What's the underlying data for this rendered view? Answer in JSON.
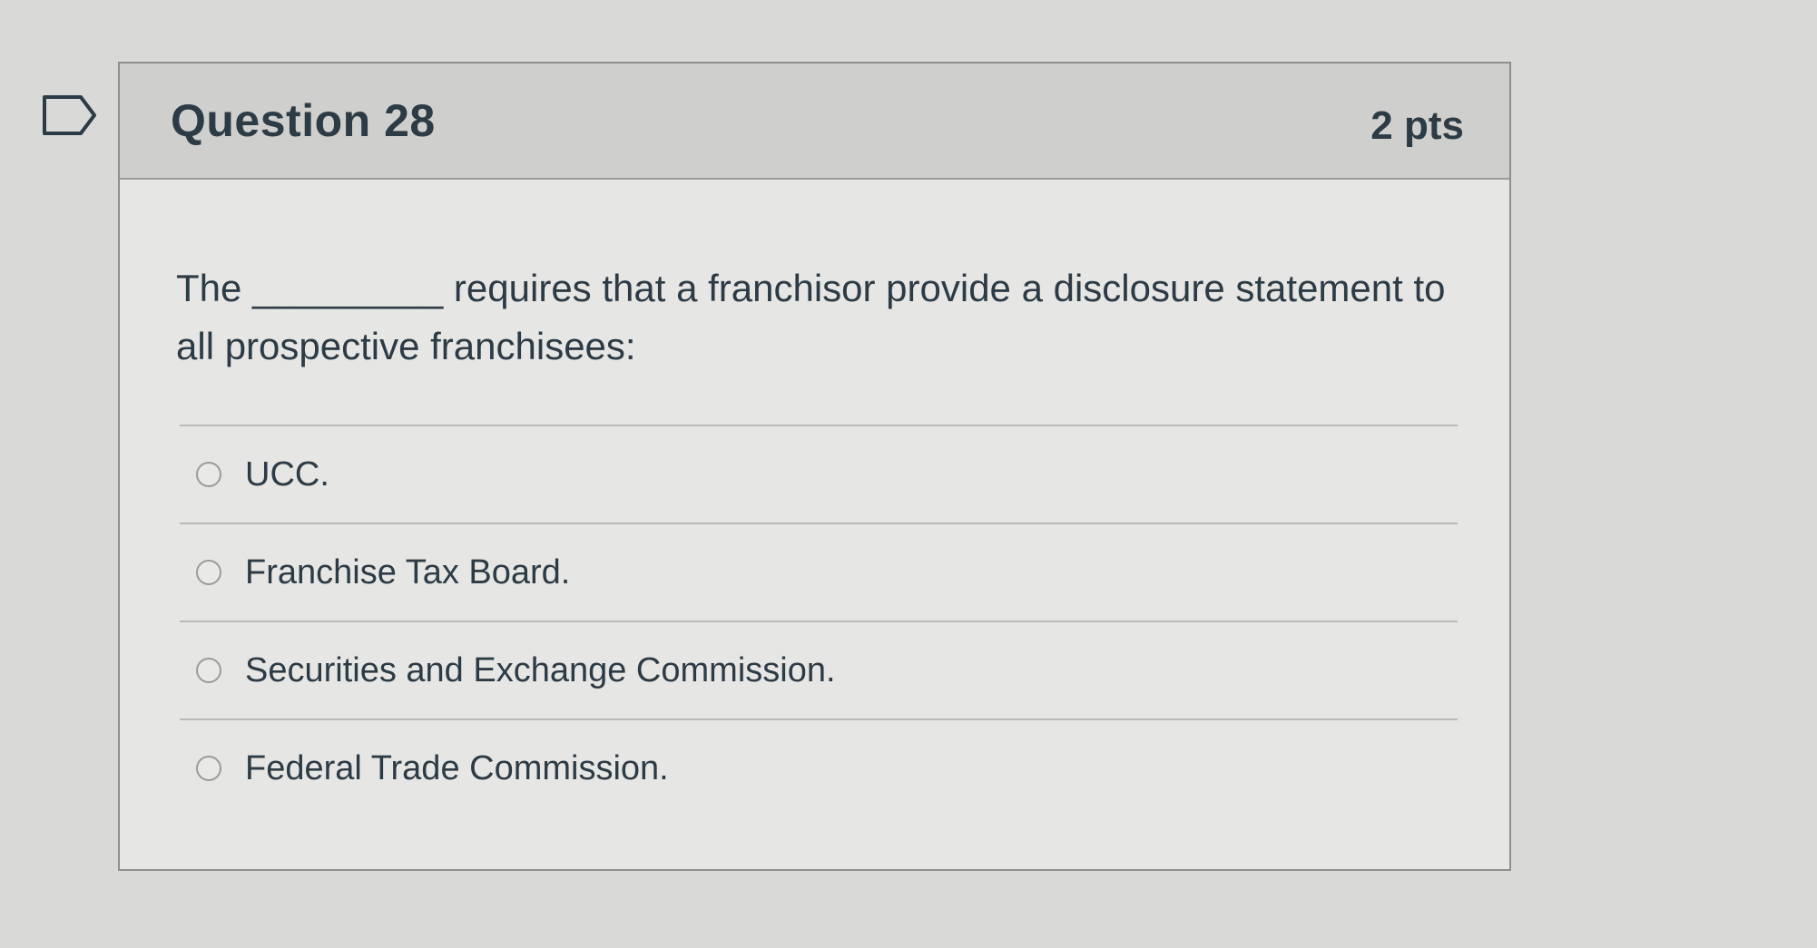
{
  "question": {
    "title": "Question 28",
    "points": "2 pts",
    "text": "The _________ requires that a franchisor provide a disclosure statement to all prospective franchisees:",
    "bookmark_icon": "bookmark-flag-icon"
  },
  "answers": [
    {
      "label": "UCC."
    },
    {
      "label": "Franchise Tax Board."
    },
    {
      "label": "Securities and Exchange Commission."
    },
    {
      "label": "Federal Trade Commission."
    }
  ],
  "colors": {
    "background": "#d9d9d7",
    "header": "#cfcfcd",
    "card": "#e6e6e4",
    "text": "#2d3b45"
  }
}
